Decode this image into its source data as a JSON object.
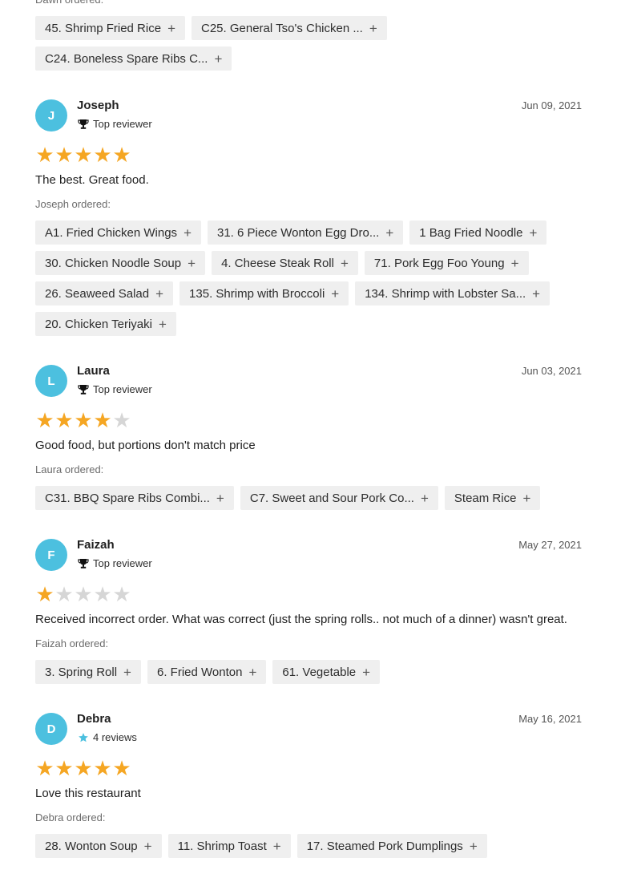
{
  "top_section": {
    "ordered_label": "Dawn ordered:",
    "items": [
      {
        "label": "45. Shrimp Fried Rice"
      },
      {
        "label": "C25. General Tso's Chicken ..."
      },
      {
        "label": "C24. Boneless Spare Ribs C..."
      }
    ]
  },
  "reviews": [
    {
      "initial": "J",
      "name": "Joseph",
      "badge": "Top reviewer",
      "badge_icon": "trophy-icon",
      "date": "Jun 09, 2021",
      "rating": 5,
      "text": "The best. Great food.",
      "ordered_label": "Joseph ordered:",
      "items": [
        {
          "label": "A1. Fried Chicken Wings"
        },
        {
          "label": "31. 6 Piece Wonton Egg Dro..."
        },
        {
          "label": "1 Bag Fried Noodle"
        },
        {
          "label": "30. Chicken Noodle Soup"
        },
        {
          "label": "4. Cheese Steak Roll"
        },
        {
          "label": "71. Pork Egg Foo Young"
        },
        {
          "label": "26. Seaweed Salad"
        },
        {
          "label": "135. Shrimp with Broccoli"
        },
        {
          "label": "134. Shrimp with Lobster Sa..."
        },
        {
          "label": "20. Chicken Teriyaki"
        }
      ]
    },
    {
      "initial": "L",
      "name": "Laura",
      "badge": "Top reviewer",
      "badge_icon": "trophy-icon",
      "date": "Jun 03, 2021",
      "rating": 4,
      "text": "Good food, but portions don't match price",
      "ordered_label": "Laura ordered:",
      "items": [
        {
          "label": "C31. BBQ Spare Ribs Combi..."
        },
        {
          "label": "C7. Sweet and Sour Pork Co..."
        },
        {
          "label": "Steam Rice"
        }
      ]
    },
    {
      "initial": "F",
      "name": "Faizah",
      "badge": "Top reviewer",
      "badge_icon": "trophy-icon",
      "date": "May 27, 2021",
      "rating": 1,
      "text": "Received incorrect order. What was correct (just the spring rolls.. not much of a dinner) wasn't great.",
      "ordered_label": "Faizah ordered:",
      "items": [
        {
          "label": "3. Spring Roll"
        },
        {
          "label": "6. Fried Wonton"
        },
        {
          "label": "61. Vegetable"
        }
      ]
    },
    {
      "initial": "D",
      "name": "Debra",
      "badge": "4 reviews",
      "badge_icon": "star-icon",
      "date": "May 16, 2021",
      "rating": 5,
      "text": "Love this restaurant",
      "ordered_label": "Debra ordered:",
      "items": [
        {
          "label": "28. Wonton Soup"
        },
        {
          "label": "11. Shrimp Toast"
        },
        {
          "label": "17. Steamed Pork Dumplings"
        }
      ]
    }
  ],
  "colors": {
    "avatar": "#4cc0df",
    "star_on": "#f5a623",
    "star_off": "#d6d6d6",
    "chip_bg": "#efefef"
  }
}
